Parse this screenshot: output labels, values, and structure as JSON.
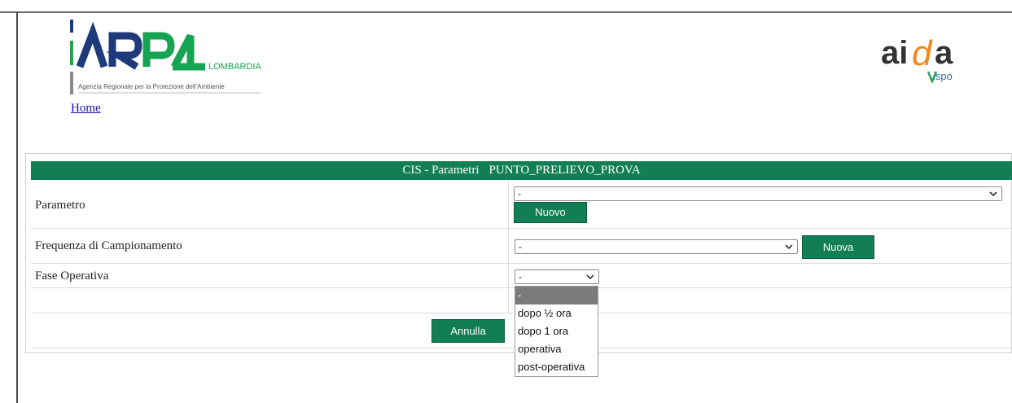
{
  "header": {
    "arpa_region": "LOMBARDIA",
    "arpa_subtitle": "Agenzia Regionale per la Protezione dell'Ambiente",
    "home_link": "Home",
    "aida_logo_text": "aida",
    "aida_sub": "vispo"
  },
  "panel": {
    "title_prefix": "CIS - Parametri",
    "title_point": "PUNTO_PRELIEVO_PROVA",
    "rows": {
      "parametro": {
        "label": "Parametro",
        "value": "-",
        "button": "Nuovo"
      },
      "frequenza": {
        "label": "Frequenza di Campionamento",
        "value": "-",
        "button": "Nuova"
      },
      "fase": {
        "label": "Fase Operativa",
        "value": "-"
      }
    },
    "cancel_button": "Annulla"
  },
  "fase_options": [
    {
      "label": "-"
    },
    {
      "label": "dopo ½ ora"
    },
    {
      "label": "dopo 1 ora"
    },
    {
      "label": "operativa"
    },
    {
      "label": "post-operativa"
    }
  ],
  "colors": {
    "brand_green": "#127e55",
    "arpa_green": "#16a352",
    "aida_orange": "#f08a1c"
  }
}
